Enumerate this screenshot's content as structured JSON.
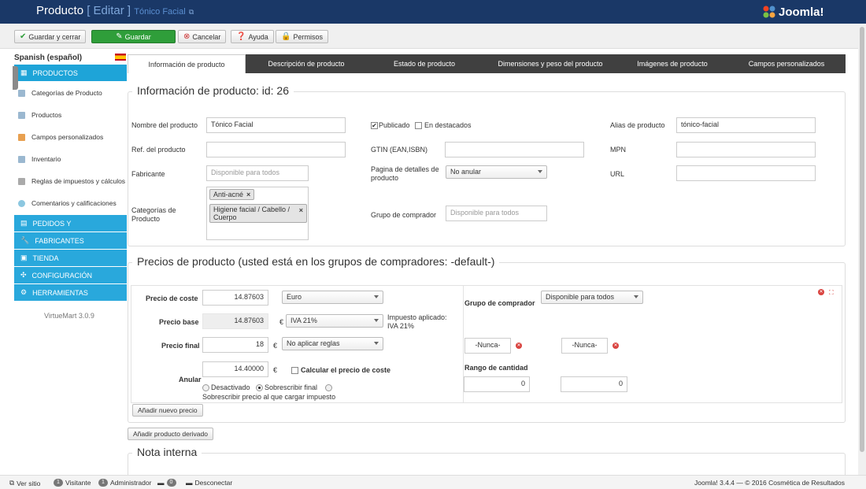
{
  "header": {
    "title": "Producto",
    "edit_label": "[ Editar ]",
    "product_name": "Tónico Facial",
    "logo_text": "Joomla!"
  },
  "toolbar": {
    "save_close": "Guardar y cerrar",
    "save": "Guardar",
    "cancel": "Cancelar",
    "help": "Ayuda",
    "permissions": "Permisos"
  },
  "sidebar": {
    "language": "Spanish (español)",
    "sections": [
      "PRODUCTOS",
      "PEDIDOS Y",
      "FABRICANTES",
      "TIENDA",
      "CONFIGURACIÓN",
      "HERRAMIENTAS"
    ],
    "items": [
      "Categorías de Producto",
      "Productos",
      "Campos personalizados",
      "Inventario",
      "Reglas de impuestos y cálculos",
      "Comentarios y calificaciones"
    ],
    "version": "VirtueMart 3.0.9"
  },
  "tabs": [
    "Información de producto",
    "Descripción de producto",
    "Estado de producto",
    "Dimensiones y peso del producto",
    "Imágenes de producto",
    "Campos personalizados"
  ],
  "info": {
    "legend": "Información de producto: id: 26",
    "name_label": "Nombre del producto",
    "name_value": "Tónico Facial",
    "published_label": "Publicado",
    "featured_label": "En destacados",
    "alias_label": "Alias de producto",
    "alias_value": "tónico-facial",
    "ref_label": "Ref. del producto",
    "gtin_label": "GTIN (EAN,ISBN)",
    "mpn_label": "MPN",
    "manufacturer_label": "Fabricante",
    "manufacturer_placeholder": "Disponible para todos",
    "detail_page_label": "Pagina de detalles de producto",
    "detail_page_value": "No anular",
    "url_label": "URL",
    "categories_label": "Categorías de Producto",
    "categories": [
      "Anti-acné",
      "Higiene facial / Cabello / Cuerpo"
    ],
    "buyer_group_label": "Grupo de comprador",
    "buyer_group_placeholder": "Disponible para todos"
  },
  "prices": {
    "legend": "Precios de producto (usted está en los grupos de compradores: -default-)",
    "cost_label": "Precio de coste",
    "cost_value": "14.87603",
    "currency": "Euro",
    "base_label": "Precio base",
    "base_value": "14.87603",
    "euro_sign": "€",
    "tax": "IVA 21%",
    "tax_applied": "Impuesto aplicado: IVA 21%",
    "final_label": "Precio final",
    "final_value": "18",
    "rules": "No aplicar reglas",
    "override_label": "Anular",
    "override_value": "14.40000",
    "calc_cost_label": "Calcular el precio de coste",
    "opt_disabled": "Desactivado",
    "opt_override_final": "Sobrescribir final",
    "opt_override_pre_tax": "Sobrescribir precio al que cargar impuesto",
    "buyer_group_label": "Grupo de comprador",
    "buyer_group_value": "Disponible para todos",
    "never1": "-Nunca-",
    "never2": "-Nunca-",
    "qty_range_label": "Rango de cantidad",
    "qty_from": "0",
    "qty_to": "0",
    "add_price": "Añadir nuevo precio"
  },
  "add_derived": "Añadir producto derivado",
  "notes_legend": "Nota interna",
  "statusbar": {
    "view_site": "Ver sitio",
    "visitors_count": "1",
    "visitors_label": "Visitante",
    "admins_count": "1",
    "admins_label": "Administrador",
    "messages_count": "0",
    "logout": "Desconectar",
    "footer": "Joomla! 3.4.4 — © 2016 Cosmética de Resultados"
  }
}
